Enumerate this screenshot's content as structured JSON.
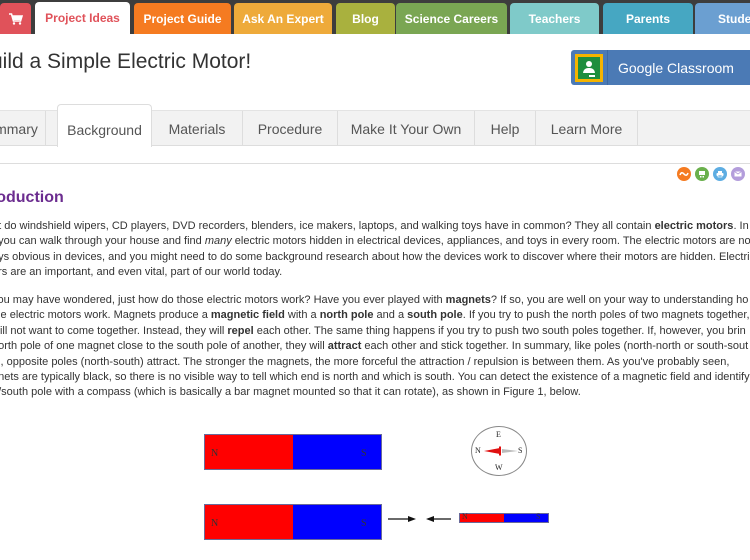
{
  "topnav": {
    "cart_icon": "shopping-cart-icon",
    "tabs": [
      {
        "label": "Project Ideas",
        "color": "#e0525a",
        "active": true
      },
      {
        "label": "Project Guide",
        "color": "#f57b21"
      },
      {
        "label": "Ask An Expert",
        "color": "#eeaa3a"
      },
      {
        "label": "Blog",
        "color": "#a9b13e"
      },
      {
        "label": "Science Careers",
        "color": "#7aa653"
      },
      {
        "label": "Teachers",
        "color": "#7fcac9"
      },
      {
        "label": "Parents",
        "color": "#46a7c2"
      },
      {
        "label": "Studen",
        "color": "#6b9fd1"
      }
    ]
  },
  "header": {
    "title": "uild a Simple Electric Motor!",
    "google_classroom": "Google Classroom"
  },
  "subtabs": [
    {
      "label": "mmary"
    },
    {
      "label": "Background",
      "active": true
    },
    {
      "label": "Materials"
    },
    {
      "label": "Procedure"
    },
    {
      "label": "Make It Your Own"
    },
    {
      "label": "Help"
    },
    {
      "label": "Learn More"
    }
  ],
  "share_icons": [
    {
      "name": "rss-icon",
      "color": "#f57b21"
    },
    {
      "name": "cart-icon",
      "color": "#6ab04c"
    },
    {
      "name": "print-icon",
      "color": "#5dade2"
    },
    {
      "name": "email-icon",
      "color": "#b39ddb"
    }
  ],
  "content": {
    "heading": "roduction",
    "para1": [
      [
        "at do windshield wipers, CD players, DVD recorders, blenders, ice makers, laptops, and walking toys have in common? They all contain ",
        {
          "b": "electric motors"
        },
        ". In"
      ],
      [
        ", you can walk through your house and find ",
        {
          "i": "many"
        },
        " electric motors hidden in electrical devices, appliances, and toys in every room. The electric motors are no"
      ],
      [
        "ays obvious in devices, and you might need to do some background research about how the devices work to discover where their motors are hidden. Electri"
      ],
      [
        "ors are an important, and even vital, part of our world today."
      ]
    ],
    "para2": [
      [
        " you may have wondered, just how do those electric motors work? Have you ever played with ",
        {
          "b": "magnets"
        },
        "? If so, you are well on your way to understanding ho"
      ],
      [
        "ple electric motors work. Magnets produce a ",
        {
          "b": "magnetic field"
        },
        " with a ",
        {
          "b": "north pole"
        },
        " and a ",
        {
          "b": "south pole"
        },
        ". If you try to push the north poles of two magnets together,"
      ],
      [
        " will not want to come together. Instead, they will ",
        {
          "b": "repel"
        },
        " each other. The same thing happens if you try to push two south poles together. If, however, you brin"
      ],
      [
        "north pole of one magnet close to the south pole of another, they will ",
        {
          "b": "attract"
        },
        " each other and stick together. In summary, like poles (north-north or south-sout"
      ],
      [
        "el, opposite poles (north-south) attract. The stronger the magnets, the more forceful the attraction / repulsion is between them. As you've probably seen,"
      ],
      [
        "gnets are typically black, so there is no visible way to tell which end is north and which is south. You can detect the existence of a magnetic field and identify"
      ],
      [
        "h/south pole with a compass (which is basically a bar magnet mounted so that it can rotate), as shown in Figure 1, below."
      ]
    ]
  },
  "figure": {
    "magnet_labels": {
      "north": "N",
      "south": "S"
    },
    "compass_labels": {
      "top": "E",
      "left": "N",
      "right": "S",
      "bottom": "W"
    },
    "colors": {
      "north": "#ff0000",
      "south": "#0000ff"
    }
  }
}
